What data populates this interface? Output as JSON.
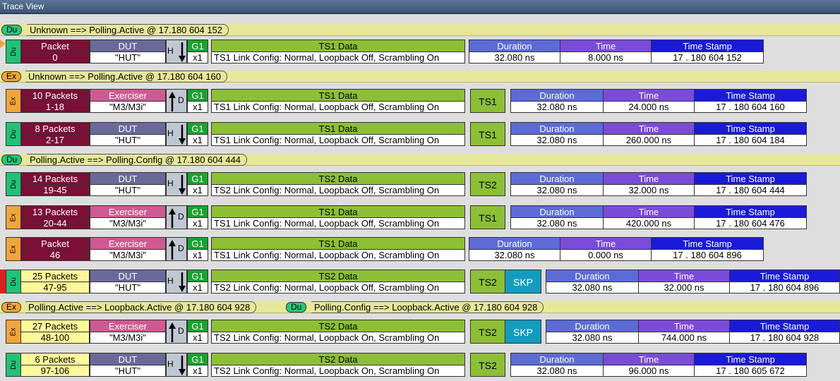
{
  "window": {
    "title": "Trace View"
  },
  "colors": {
    "dut": "#22c177",
    "exerciser": "#f0a53c",
    "data": "#8cbf36",
    "skp": "#139cbf"
  },
  "transitions": {
    "t1": {
      "tag": "Du",
      "text": "Unknown ==> Polling.Active @ 17.180 604 152"
    },
    "t2": {
      "tag": "Ex",
      "text": "Unknown ==> Polling.Active @ 17.180 604 160"
    },
    "t3": {
      "tag": "Du",
      "text": "Polling.Active ==> Polling.Config @ 17.180 604 444"
    },
    "t4a": {
      "tag": "Ex",
      "text": "Polling.Active ==> Loopback.Active @ 17.180 604 928"
    },
    "t4b": {
      "tag": "Du",
      "text": "Polling.Config ==> Loopback.Active @ 17.180 604 928"
    }
  },
  "labels": {
    "duration": "Duration",
    "time": "Time",
    "timestamp": "Time Stamp",
    "gen": "G1",
    "width": "x1",
    "h": "H",
    "d": "D",
    "skp": "SKP"
  },
  "rows": [
    {
      "side": "Du",
      "pkt_h": "Packet",
      "pkt_v": "0",
      "dev_h": "DUT",
      "dev_v": "\"HUT\"",
      "data_h": "TS1 Data",
      "data_v": "TS1 Link Config: Normal, Loopback Off, Scrambling On",
      "duration": "32.080 ns",
      "time": "8.000 ns",
      "stamp": "17 . 180 604 152"
    },
    {
      "side": "Ex",
      "pkt_h": "10 Packets",
      "pkt_v": "1-18",
      "dev_h": "Exerciser",
      "dev_v": "\"M3/M3i\"",
      "data_h": "TS1 Data",
      "data_v": "TS1 Link Config: Normal, Loopback Off, Scrambling On",
      "ts": "TS1",
      "duration": "32.080 ns",
      "time": "24.000 ns",
      "stamp": "17 . 180 604 160"
    },
    {
      "side": "Du",
      "pkt_h": "8 Packets",
      "pkt_v": "2-17",
      "dev_h": "DUT",
      "dev_v": "\"HUT\"",
      "data_h": "TS1 Data",
      "data_v": "TS1 Link Config: Normal, Loopback Off, Scrambling On",
      "ts": "TS1",
      "duration": "32.080 ns",
      "time": "260.000 ns",
      "stamp": "17 . 180 604 184"
    },
    {
      "side": "Du",
      "pkt_h": "14 Packets",
      "pkt_v": "19-45",
      "dev_h": "DUT",
      "dev_v": "\"HUT\"",
      "data_h": "TS2 Data",
      "data_v": "TS2 Link Config: Normal, Loopback Off, Scrambling On",
      "ts": "TS2",
      "duration": "32.080 ns",
      "time": "32.000 ns",
      "stamp": "17 . 180 604 444"
    },
    {
      "side": "Ex",
      "pkt_h": "13 Packets",
      "pkt_v": "20-44",
      "dev_h": "Exerciser",
      "dev_v": "\"M3/M3i\"",
      "data_h": "TS1 Data",
      "data_v": "TS1 Link Config: Normal, Loopback Off, Scrambling On",
      "ts": "TS1",
      "duration": "32.080 ns",
      "time": "420.000 ns",
      "stamp": "17 . 180 604 476"
    },
    {
      "side": "Ex",
      "pkt_h": "Packet",
      "pkt_v": "46",
      "dev_h": "Exerciser",
      "dev_v": "\"M3/M3i\"",
      "data_h": "TS1 Data",
      "data_v": "TS1 Link Config: Normal, Loopback On, Scrambling On",
      "duration": "32.080 ns",
      "time": "0.000 ns",
      "stamp": "17 . 180 604 896"
    },
    {
      "side": "Du",
      "pkt_h": "25 Packets",
      "pkt_v": "47-95",
      "dev_h": "DUT",
      "dev_v": "\"HUT\"",
      "data_h": "TS2 Data",
      "data_v": "TS2 Link Config: Normal, Loopback Off, Scrambling On",
      "ts": "TS2",
      "duration": "32.080 ns",
      "time": "32.000 ns",
      "stamp": "17 . 180 604 896"
    },
    {
      "side": "Ex",
      "pkt_h": "27 Packets",
      "pkt_v": "48-100",
      "dev_h": "Exerciser",
      "dev_v": "\"M3/M3i\"",
      "data_h": "TS2 Data",
      "data_v": "TS2 Link Config: Normal, Loopback On, Scrambling On",
      "ts": "TS2",
      "duration": "32.080 ns",
      "time": "744.000 ns",
      "stamp": "17 . 180 604 928"
    },
    {
      "side": "Du",
      "pkt_h": "6 Packets",
      "pkt_v": "97-106",
      "dev_h": "DUT",
      "dev_v": "\"HUT\"",
      "data_h": "TS2 Data",
      "data_v": "TS2 Link Config: Normal, Loopback On, Scrambling On",
      "ts": "TS2",
      "duration": "32.080 ns",
      "time": "96.000 ns",
      "stamp": "17 . 180 605 672"
    }
  ]
}
